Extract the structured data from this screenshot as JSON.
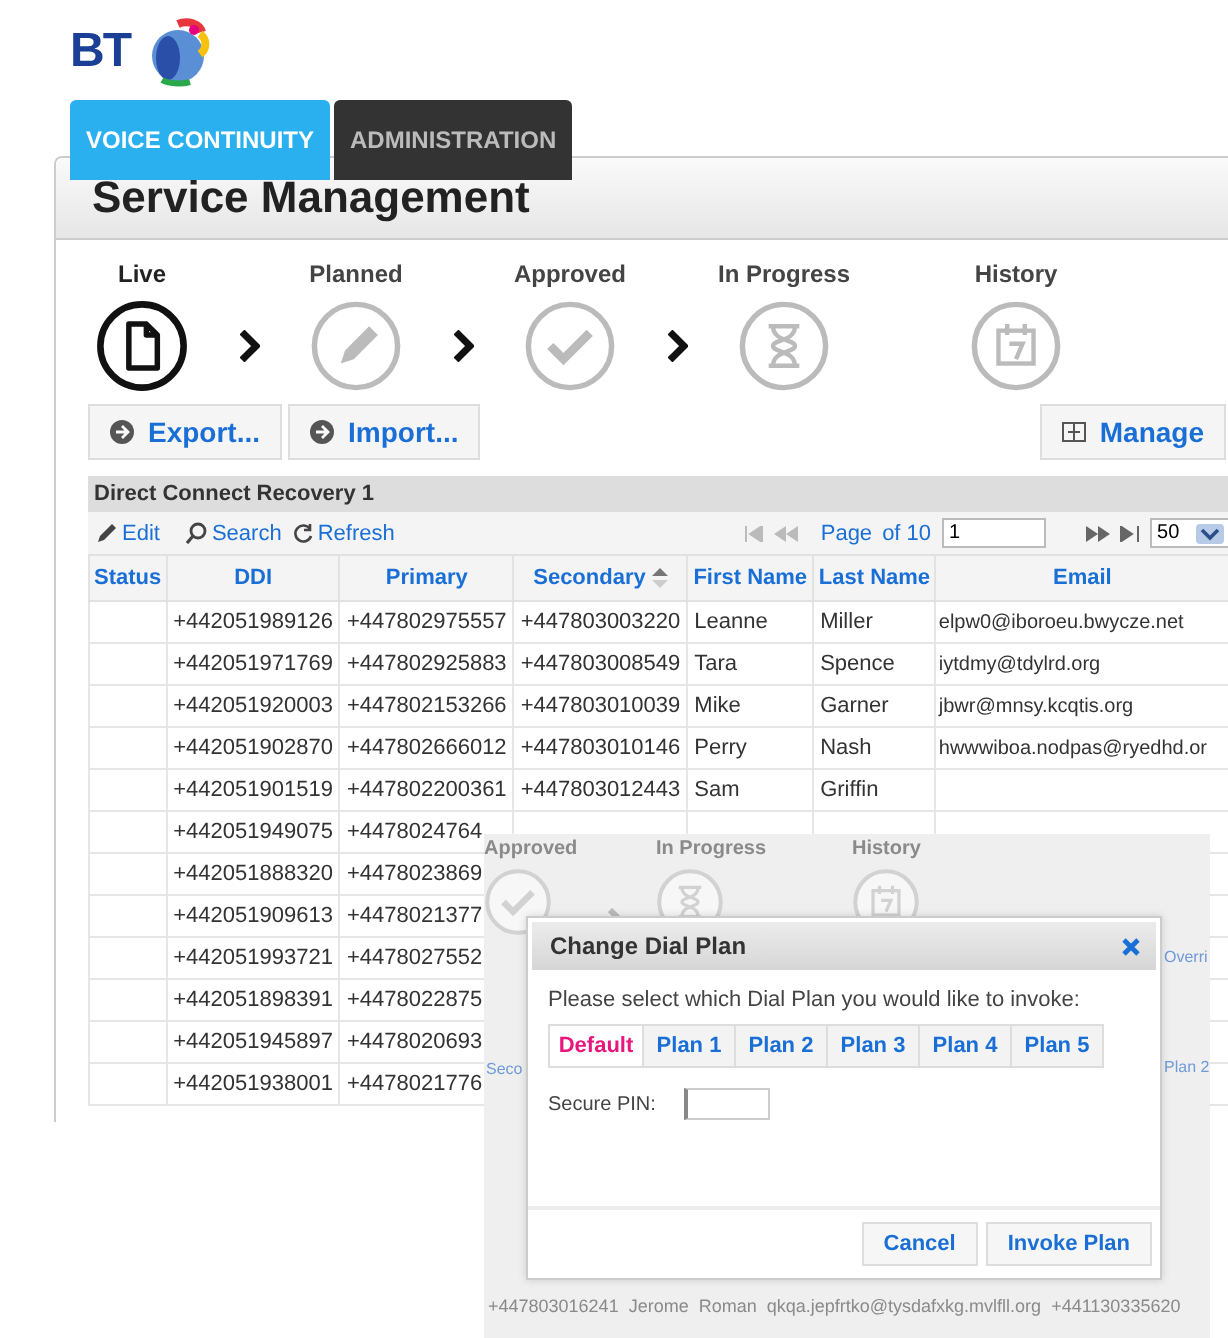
{
  "logo": {
    "text": "BT"
  },
  "tabs": [
    {
      "label": "VOICE CONTINUITY",
      "selected": true
    },
    {
      "label": "ADMINISTRATION",
      "selected": false
    }
  ],
  "page_title": "Service Management",
  "steps": [
    {
      "label": "Live",
      "active": true
    },
    {
      "label": "Planned",
      "active": false
    },
    {
      "label": "Approved",
      "active": false
    },
    {
      "label": "In Progress",
      "active": false
    },
    {
      "label": "History",
      "active": false
    }
  ],
  "actions": [
    {
      "label": "Export..."
    },
    {
      "label": "Import..."
    },
    {
      "label": "Manage"
    }
  ],
  "grid": {
    "title": "Direct Connect Recovery 1",
    "tools": [
      {
        "label": "Edit"
      },
      {
        "label": "Search"
      },
      {
        "label": "Refresh"
      }
    ],
    "pager": {
      "page_label": "Page",
      "of_label": "of 10",
      "page_value": "1",
      "page_size": "50"
    },
    "columns": [
      {
        "label": "Status",
        "sorted": false
      },
      {
        "label": "DDI",
        "sorted": false
      },
      {
        "label": "Primary",
        "sorted": false
      },
      {
        "label": "Secondary",
        "sorted": true
      },
      {
        "label": "First Name",
        "sorted": false
      },
      {
        "label": "Last Name",
        "sorted": false
      },
      {
        "label": "Email",
        "sorted": false
      }
    ],
    "rows": [
      [
        "",
        "+442051989126",
        "+447802975557",
        "+447803003220",
        "Leanne",
        "Miller",
        "elpw0@iboroeu.bwycze.net"
      ],
      [
        "",
        "+442051971769",
        "+447802925883",
        "+447803008549",
        "Tara",
        "Spence",
        "iytdmy@tdylrd.org"
      ],
      [
        "",
        "+442051920003",
        "+447802153266",
        "+447803010039",
        "Mike",
        "Garner",
        "jbwr@mnsy.kcqtis.org"
      ],
      [
        "",
        "+442051902870",
        "+447802666012",
        "+447803010146",
        "Perry",
        "Nash",
        "hwwwiboa.nodpas@ryedhd.or"
      ],
      [
        "",
        "+442051901519",
        "+447802200361",
        "+447803012443",
        "Sam",
        "Griffin"
      ],
      [
        "",
        "+442051949075",
        "+4478024764"
      ],
      [
        "",
        "+442051888320",
        "+4478023869"
      ],
      [
        "",
        "+442051909613",
        "+4478021377"
      ],
      [
        "",
        "+442051993721",
        "+4478027552"
      ],
      [
        "",
        "+442051898391",
        "+4478022875"
      ],
      [
        "",
        "+442051945897",
        "+4478020693"
      ],
      [
        "",
        "+442051938001",
        "+4478021776"
      ]
    ]
  },
  "overlay": {
    "steps": [
      {
        "label": "Approved"
      },
      {
        "label": "In Progress"
      },
      {
        "label": "History"
      }
    ],
    "fragments": [
      "Seco",
      "Overri",
      "Plan 2"
    ],
    "background_row": [
      "+447803016241",
      "Jerome",
      "Roman",
      "qkqa.jepfrtko@tysdafxkg.mvlfll.org",
      "+441130335620"
    ],
    "dialog": {
      "title": "Change Dial Plan",
      "prompt": "Please select which Dial Plan you would like to invoke:",
      "plans": [
        {
          "label": "Default",
          "selected": true
        },
        {
          "label": "Plan 1",
          "selected": false
        },
        {
          "label": "Plan 2",
          "selected": false
        },
        {
          "label": "Plan 3",
          "selected": false
        },
        {
          "label": "Plan 4",
          "selected": false
        },
        {
          "label": "Plan 5",
          "selected": false
        }
      ],
      "pin_label": "Secure PIN:",
      "buttons": [
        {
          "label": "Cancel"
        },
        {
          "label": "Invoke Plan"
        }
      ]
    }
  }
}
